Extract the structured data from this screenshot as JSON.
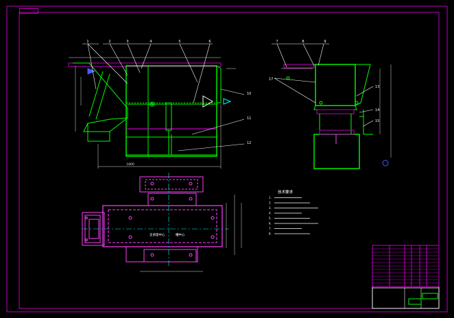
{
  "colors": {
    "background": "#000000",
    "frame": "#c000c0",
    "outline": "#00ff00",
    "hidden_line": "#ff40ff",
    "leader": "#ffffff",
    "dimension": "#e0e0e0",
    "annotation": "#00ffff",
    "accent_blue": "#4060ff"
  },
  "front_view": {
    "balloons": [
      "1",
      "2",
      "3",
      "4",
      "5",
      "6"
    ],
    "side_balloons": [
      "10",
      "11",
      "12"
    ],
    "bottom_dimension": "1800"
  },
  "side_view": {
    "balloons": [
      "7",
      "8",
      "9"
    ],
    "side_balloons": [
      "13",
      "14",
      "15"
    ],
    "left_balloon": "17"
  },
  "plan_view": {
    "label_left": "支承座中心",
    "label_right": "槽中心"
  },
  "technical_requirements": {
    "title": "技术要求",
    "items": [
      "1.",
      "2.",
      "3.",
      "4.",
      "5.",
      "6.",
      "7.",
      "8."
    ]
  },
  "title_block": {
    "rows": 12
  }
}
